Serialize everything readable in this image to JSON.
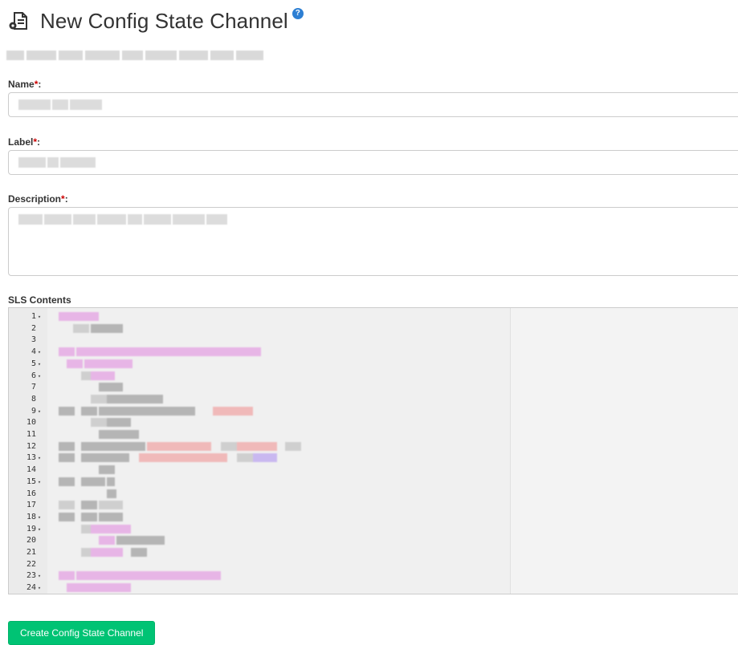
{
  "header": {
    "title": "New Config State Channel",
    "icon": "config-channel-icon",
    "help_icon_glyph": "?"
  },
  "form": {
    "name_label": "Name",
    "label_label": "Label",
    "description_label": "Description",
    "required_mark": "*",
    "colon": ":",
    "sls_label": "SLS Contents"
  },
  "editor": {
    "line_numbers": [
      "1",
      "2",
      "3",
      "4",
      "5",
      "6",
      "7",
      "8",
      "9",
      "10",
      "11",
      "12",
      "13",
      "14",
      "15",
      "16",
      "17",
      "18",
      "19",
      "20",
      "21",
      "22",
      "23",
      "24"
    ],
    "fold_lines": [
      1,
      4,
      5,
      6,
      9,
      13,
      15,
      18,
      19,
      23,
      24
    ],
    "syntax_colors": {
      "key": "#e7b5e6",
      "plain": "#cfcfcf",
      "dark": "#b5b5b5",
      "string": "#f0b9b9",
      "accent": "#c9b8f0"
    }
  },
  "actions": {
    "submit_label": "Create Config State Channel",
    "submit_color": "#00c374"
  }
}
